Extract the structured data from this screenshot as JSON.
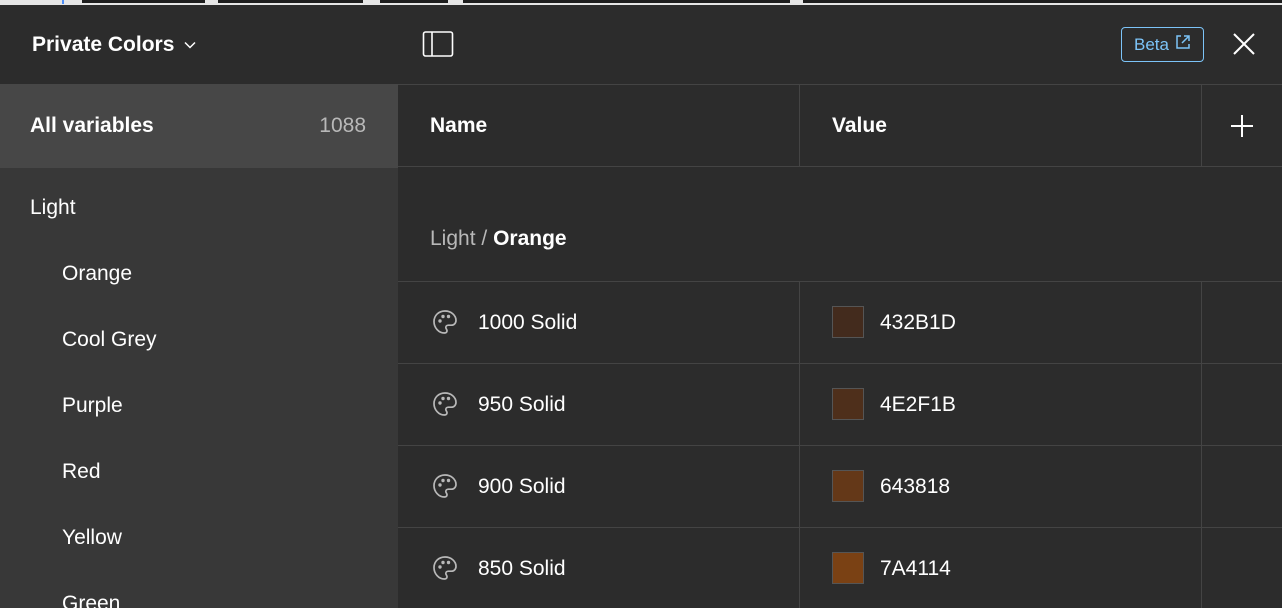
{
  "sidebar": {
    "collection_title": "Private Colors",
    "all_variables": {
      "label": "All variables",
      "count": "1088"
    },
    "group": "Light",
    "items": [
      "Orange",
      "Cool Grey",
      "Purple",
      "Red",
      "Yellow",
      "Green"
    ]
  },
  "toolbar": {
    "beta_label": "Beta"
  },
  "table": {
    "col_name": "Name",
    "col_value": "Value",
    "group_path": {
      "parent": "Light",
      "separator": " / ",
      "child": "Orange"
    },
    "rows": [
      {
        "name": "1000 Solid",
        "value": "432B1D",
        "color": "#432B1D"
      },
      {
        "name": "950 Solid",
        "value": "4E2F1B",
        "color": "#4E2F1B"
      },
      {
        "name": "900 Solid",
        "value": "643818",
        "color": "#643818"
      },
      {
        "name": "850 Solid",
        "value": "7A4114",
        "color": "#7A4114"
      }
    ]
  },
  "colors": {
    "accent": "#7cc4f8",
    "sidebar_bg": "#383838",
    "selected_bg": "#474747",
    "panel_bg": "#2c2c2c"
  },
  "icons": {
    "panel_toggle": "sidebar-toggle-icon",
    "external": "external-link-icon",
    "close": "close-icon",
    "add": "plus-icon",
    "variable": "palette-icon",
    "chevron": "chevron-down-icon"
  }
}
